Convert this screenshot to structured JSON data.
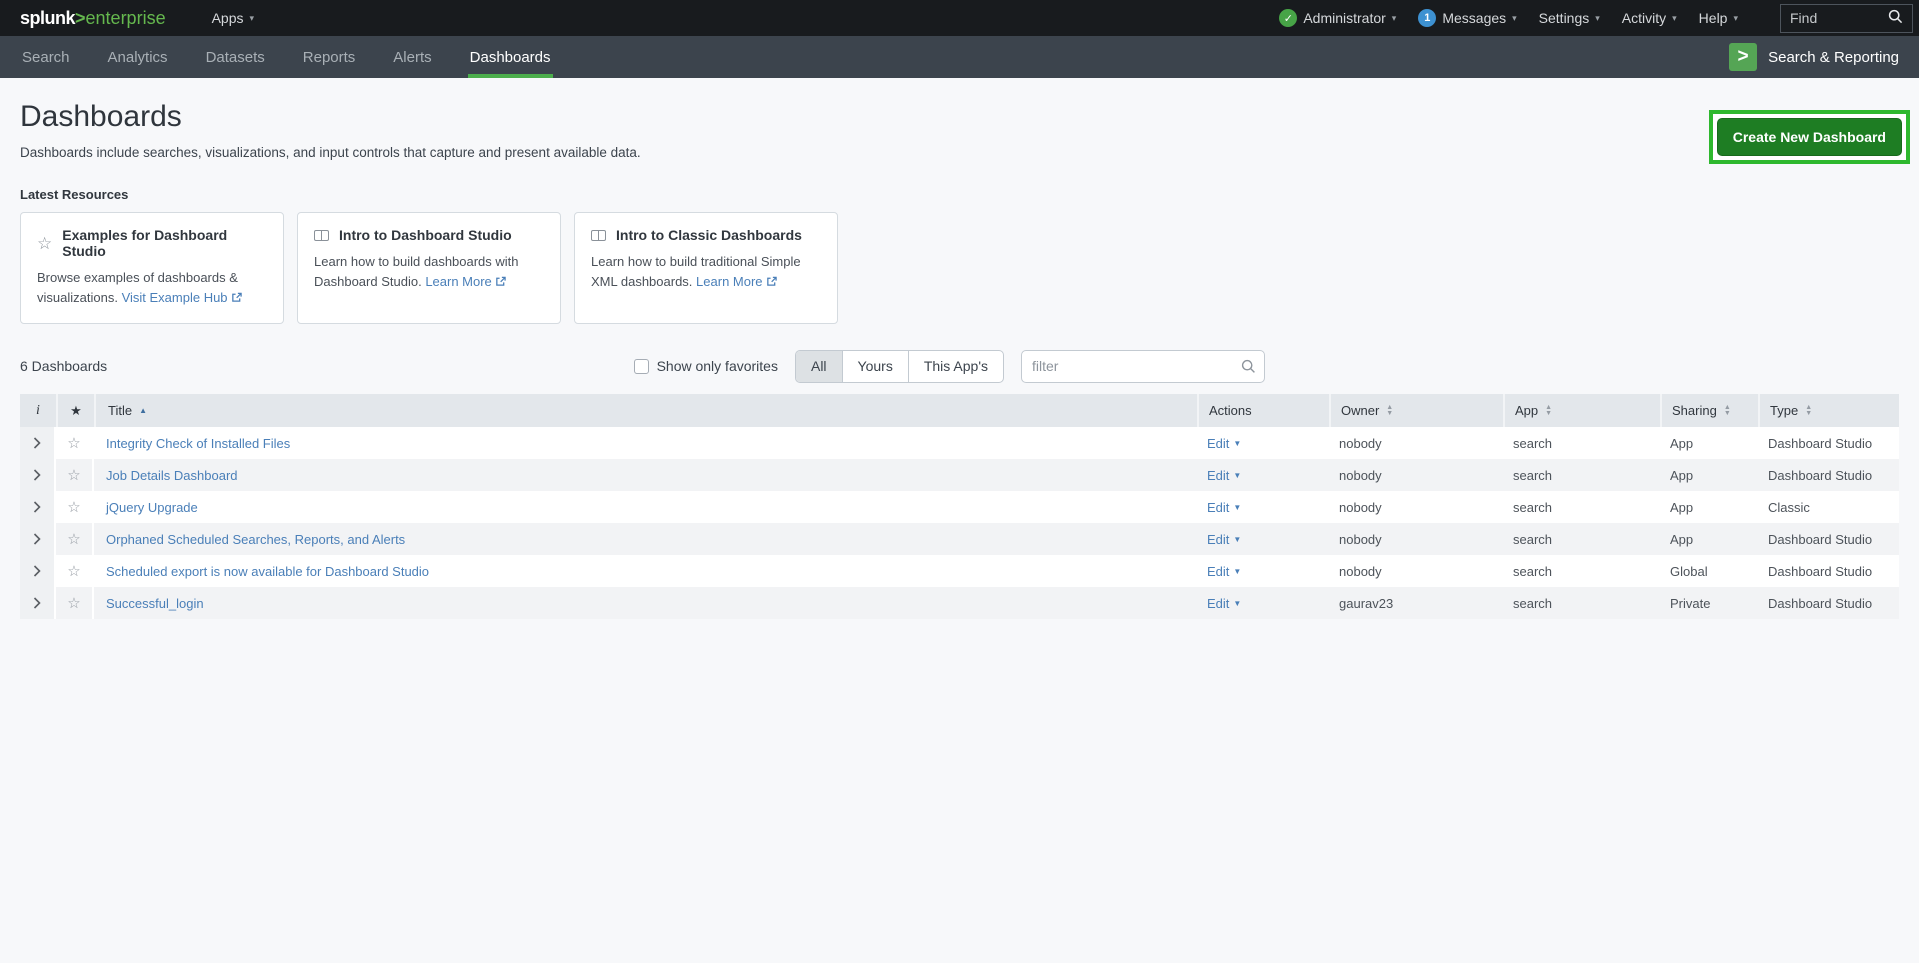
{
  "topbar": {
    "logo_brand": "splunk",
    "logo_gt": ">",
    "logo_product": "enterprise",
    "apps_label": "Apps",
    "user_label": "Administrator",
    "messages_count": "1",
    "messages_label": "Messages",
    "settings_label": "Settings",
    "activity_label": "Activity",
    "help_label": "Help",
    "find_placeholder": "Find"
  },
  "appbar": {
    "tabs": [
      {
        "label": "Search"
      },
      {
        "label": "Analytics"
      },
      {
        "label": "Datasets"
      },
      {
        "label": "Reports"
      },
      {
        "label": "Alerts"
      },
      {
        "label": "Dashboards"
      }
    ],
    "active_tab": "Dashboards",
    "app_icon_glyph": ">",
    "app_name": "Search & Reporting"
  },
  "page": {
    "title": "Dashboards",
    "description": "Dashboards include searches, visualizations, and input controls that capture and present available data.",
    "create_button_label": "Create New Dashboard",
    "latest_resources_label": "Latest Resources",
    "cards": [
      {
        "icon": "star-icon",
        "title": "Examples for Dashboard Studio",
        "body": "Browse examples of dashboards & visualizations.",
        "link": "Visit Example Hub"
      },
      {
        "icon": "book-icon",
        "title": "Intro to Dashboard Studio",
        "body": "Learn how to build dashboards with Dashboard Studio.",
        "link": "Learn More"
      },
      {
        "icon": "book-icon",
        "title": "Intro to Classic Dashboards",
        "body": "Learn how to build traditional Simple XML dashboards.",
        "link": "Learn More"
      }
    ],
    "count_label": "6 Dashboards",
    "favorites_label": "Show only favorites",
    "favorites_checked": false,
    "filter_buttons": [
      {
        "label": "All",
        "active": true
      },
      {
        "label": "Yours",
        "active": false
      },
      {
        "label": "This App's",
        "active": false
      }
    ],
    "filter_placeholder": "filter"
  },
  "table": {
    "headers": {
      "info": "i",
      "star": "★",
      "title": "Title",
      "actions": "Actions",
      "owner": "Owner",
      "app": "App",
      "sharing": "Sharing",
      "type": "Type"
    },
    "sorted_by": "Title ascending",
    "action_label": "Edit",
    "rows": [
      {
        "title": "Integrity Check of Installed Files",
        "action": "Edit",
        "owner": "nobody",
        "app": "search",
        "sharing": "App",
        "type": "Dashboard Studio"
      },
      {
        "title": "Job Details Dashboard",
        "action": "Edit",
        "owner": "nobody",
        "app": "search",
        "sharing": "App",
        "type": "Dashboard Studio"
      },
      {
        "title": "jQuery Upgrade",
        "action": "Edit",
        "owner": "nobody",
        "app": "search",
        "sharing": "App",
        "type": "Classic"
      },
      {
        "title": "Orphaned Scheduled Searches, Reports, and Alerts",
        "action": "Edit",
        "owner": "nobody",
        "app": "search",
        "sharing": "App",
        "type": "Dashboard Studio"
      },
      {
        "title": "Scheduled export is now available for Dashboard Studio",
        "action": "Edit",
        "owner": "nobody",
        "app": "search",
        "sharing": "Global",
        "type": "Dashboard Studio"
      },
      {
        "title": "Successful_login",
        "action": "Edit",
        "owner": "gaurav23",
        "app": "search",
        "sharing": "Private",
        "type": "Dashboard Studio"
      }
    ]
  },
  "colors": {
    "topbar_bg": "#181b1e",
    "appbar_bg": "#3c444d",
    "brand_green": "#65b84e",
    "active_tab_underline": "#4cae4c",
    "create_button_green": "#1e7d23",
    "annotation_green": "#2eb82e",
    "link_blue": "#4a7fb8",
    "table_header_bg": "#e3e7eb",
    "row_stripe": "#f2f3f5"
  }
}
